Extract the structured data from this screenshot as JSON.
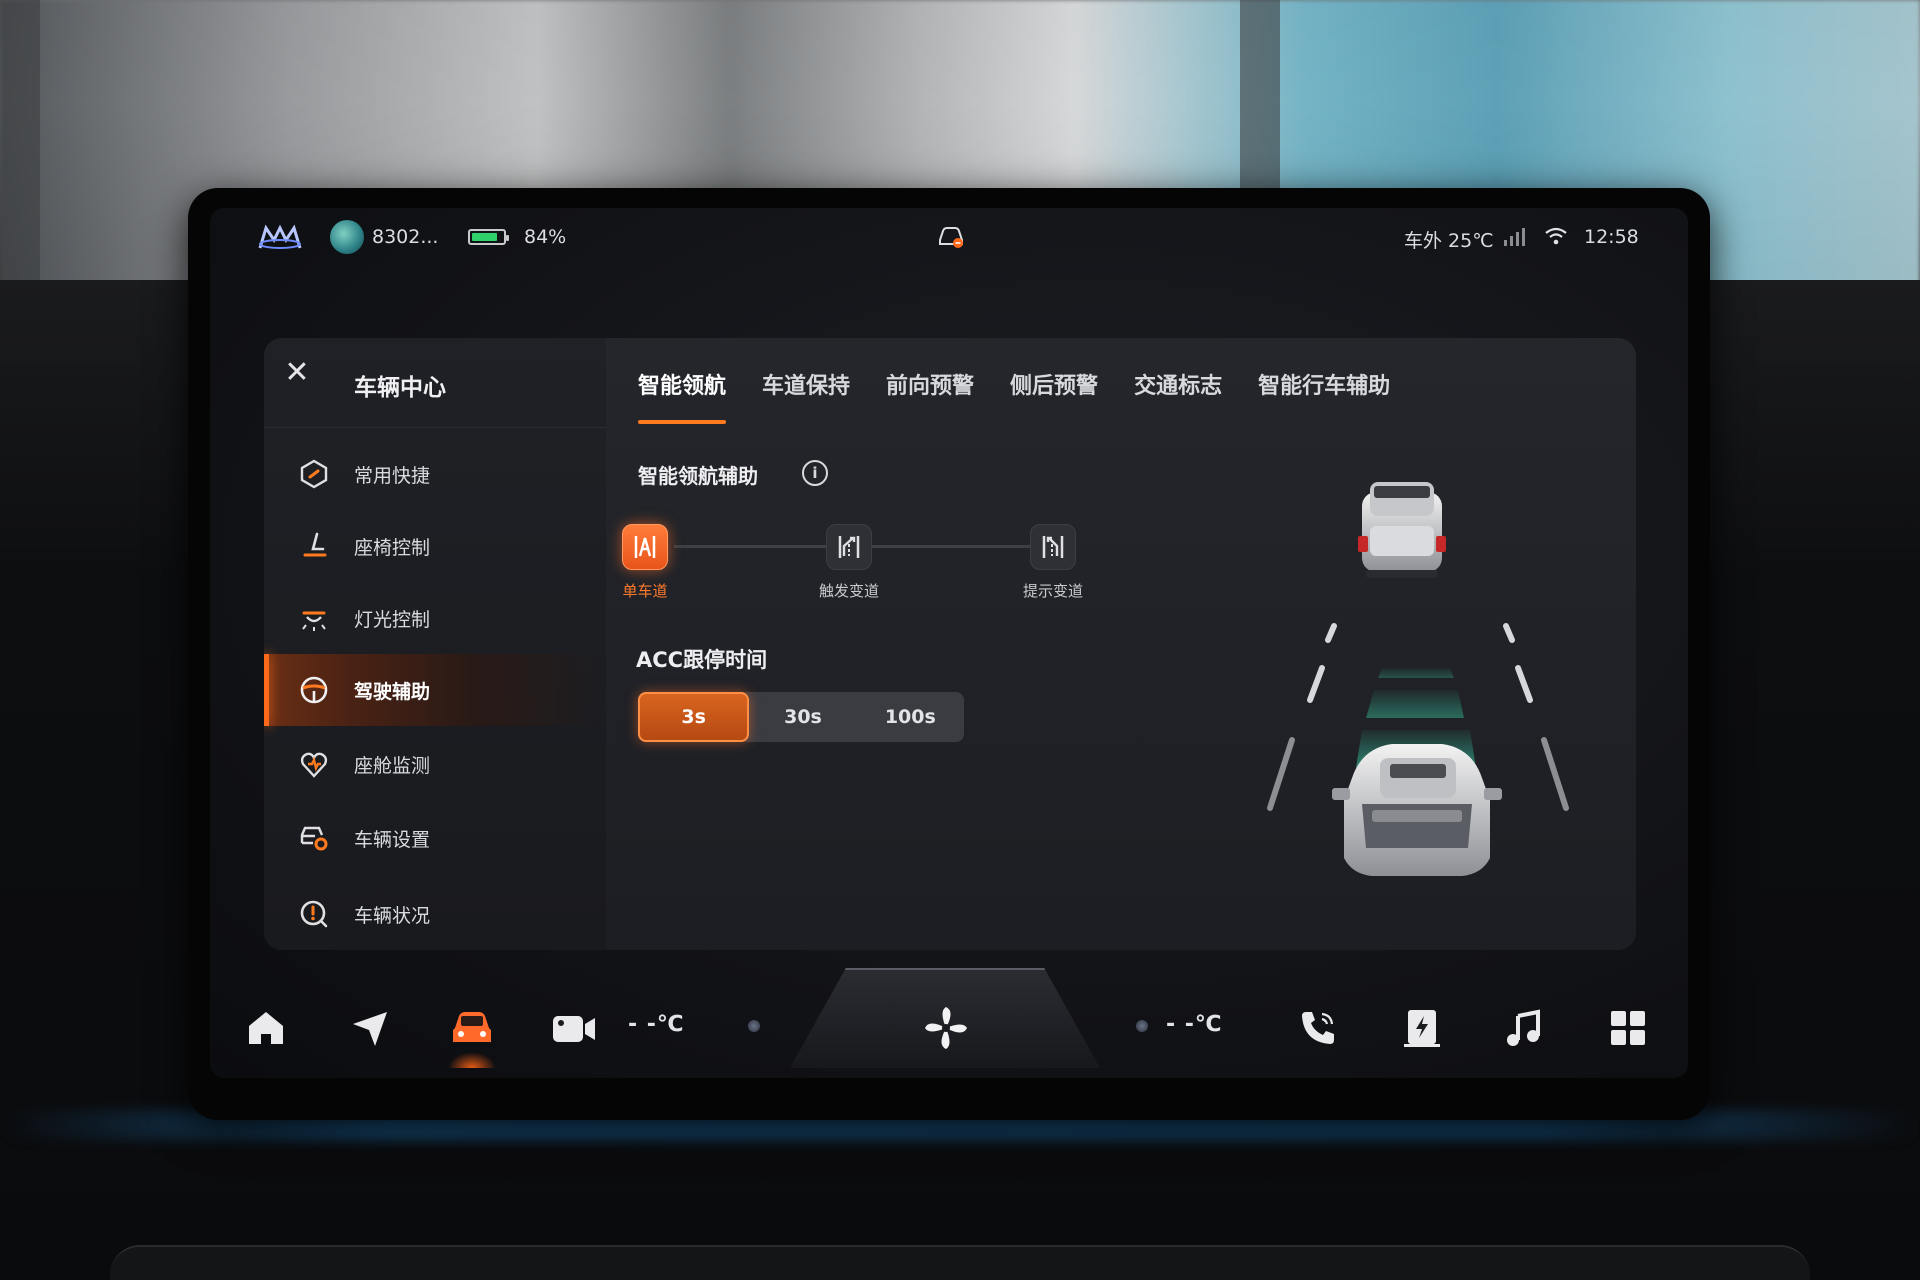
{
  "statusbar": {
    "profile_name": "8302...",
    "battery_percent": "84%",
    "battery_level": 0.84,
    "outside_temp": "车外 25℃",
    "time": "12:58"
  },
  "sidebar": {
    "title": "车辆中心",
    "items": [
      {
        "label": "常用快捷",
        "icon": "shortcut-hexagon-icon"
      },
      {
        "label": "座椅控制",
        "icon": "seat-icon"
      },
      {
        "label": "灯光控制",
        "icon": "light-icon"
      },
      {
        "label": "驾驶辅助",
        "icon": "steering-wheel-icon",
        "active": true
      },
      {
        "label": "座舱监测",
        "icon": "cabin-monitor-icon"
      },
      {
        "label": "车辆设置",
        "icon": "vehicle-settings-icon"
      },
      {
        "label": "车辆状况",
        "icon": "vehicle-status-icon"
      }
    ]
  },
  "tabs": [
    {
      "label": "智能领航",
      "active": true
    },
    {
      "label": "车道保持"
    },
    {
      "label": "前向预警"
    },
    {
      "label": "侧后预警"
    },
    {
      "label": "交通标志"
    },
    {
      "label": "智能行车辅助"
    }
  ],
  "navigation_assist": {
    "title": "智能领航辅助",
    "modes": [
      {
        "label": "单车道",
        "active": true
      },
      {
        "label": "触发变道"
      },
      {
        "label": "提示变道"
      }
    ]
  },
  "acc": {
    "title": "ACC跟停时间",
    "options": [
      {
        "label": "3s",
        "active": true
      },
      {
        "label": "30s"
      },
      {
        "label": "100s"
      }
    ]
  },
  "dock": {
    "left_temp": "- -℃",
    "right_temp": "- -℃",
    "items": [
      "home-icon",
      "navigation-icon",
      "vehicle-icon",
      "camera-icon",
      "fan-icon",
      "phone-icon",
      "charging-icon",
      "music-icon",
      "apps-grid-icon"
    ]
  },
  "colors": {
    "accent": "#ff7a1f",
    "active_green": "#2fd26a",
    "lane_green": "#2f8f78"
  }
}
